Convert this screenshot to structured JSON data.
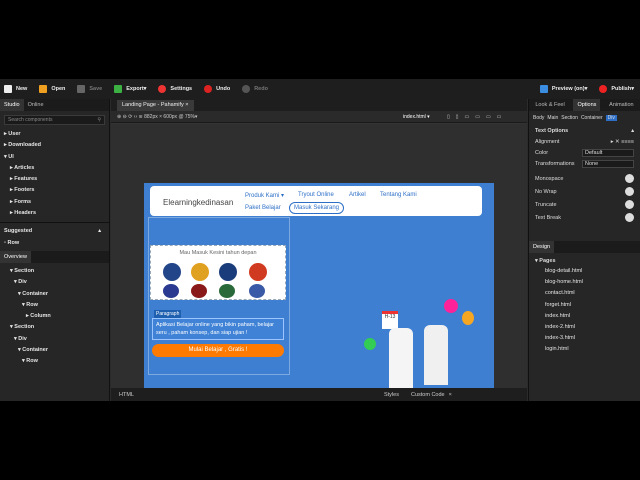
{
  "toolbar": {
    "new": "New",
    "open": "Open",
    "save": "Save",
    "export": "Export",
    "settings": "Settings",
    "undo": "Undo",
    "redo": "Redo",
    "preview": "Preview (on)",
    "publish": "Publish"
  },
  "left": {
    "tabs": [
      "Studio",
      "Online"
    ],
    "search_placeholder": "Search components",
    "components": [
      "User",
      "Downloaded",
      "UI",
      "Articles",
      "Features",
      "Footers",
      "Forms",
      "Headers"
    ],
    "suggested_title": "Suggested",
    "suggested_item": "Row",
    "overview_title": "Overview",
    "overview": [
      "Section",
      "Div",
      "Container",
      "Row",
      "Column",
      "Section",
      "Div",
      "Container",
      "Row"
    ]
  },
  "center": {
    "doc_tab": "Landing Page - Pahamify",
    "size": "882px × 600px @ 75%",
    "page_select": "index.html"
  },
  "site": {
    "brand": "Elearningkedinasan",
    "nav": [
      "Produk Kami",
      "Tryout Online",
      "Artikel",
      "Tentang Kami"
    ],
    "nav2": [
      "Paket Belajar",
      "Masuk Sekarang"
    ],
    "card_title": "Mau Masuk Kesini tahun depan",
    "para_tag": "Paragraph",
    "paragraph": "Aplikasi Belajar online yang bikin paham, belajar seru , paham konsep, dan siap ujian !",
    "cta": "Mulai Belajar , Gratis !",
    "badge": "H-13",
    "colors": {
      "bg": "#3e7fd2",
      "cta": "#ff7a00"
    }
  },
  "right": {
    "tabs": [
      "Look & Feel",
      "Options",
      "Animation"
    ],
    "subtabs": [
      "Body",
      "Main",
      "Section",
      "Container",
      "Div"
    ],
    "section_title": "Text Options",
    "alignment": "Alignment",
    "color_label": "Color",
    "color_value": "Default",
    "transform_label": "Transformations",
    "transform_value": "None",
    "toggles": [
      "Monospace",
      "No Wrap",
      "Truncate",
      "Text Break"
    ],
    "design": "Design",
    "pages_title": "Pages",
    "pages": [
      "blog-detail.html",
      "blog-home.html",
      "contact.html",
      "forget.html",
      "index.html",
      "index-2.html",
      "index-3.html",
      "login.html"
    ]
  },
  "bottom": {
    "html": "HTML",
    "styles": "Styles",
    "custom": "Custom Code"
  }
}
